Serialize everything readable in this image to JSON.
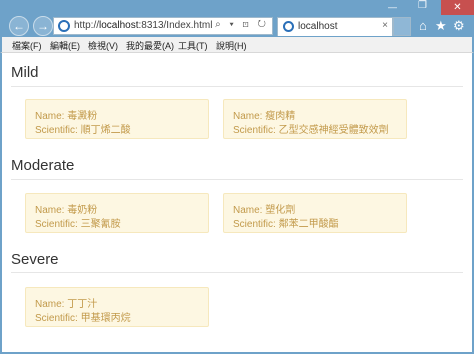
{
  "browser": {
    "url_prefix": "http://",
    "url_host": "localhost",
    "url_rest": ":8313/Index.html",
    "address_icons": "⌕ ▾ ⊡ ↻",
    "tab_title": "localhost",
    "tab_close": "×",
    "window_controls": {
      "minimize": "—",
      "maximize": "❐",
      "close": "✕"
    },
    "nav_back": "←",
    "nav_forward": "→",
    "tool_icons": {
      "home": "⌂",
      "favorites": "★",
      "settings": "⚙"
    }
  },
  "menu": [
    "檔案(F)",
    "編輯(E)",
    "檢視(V)",
    "我的最愛(A)",
    "工具(T)",
    "說明(H)"
  ],
  "sections": [
    {
      "title": "Mild",
      "cards": [
        {
          "name": "Name: 毒澱粉",
          "scientific": "Scientific: 順丁烯二酸"
        },
        {
          "name": "Name: 瘦肉精",
          "scientific": "Scientific: 乙型交感神經受體致效劑"
        }
      ]
    },
    {
      "title": "Moderate",
      "cards": [
        {
          "name": "Name: 毒奶粉",
          "scientific": "Scientific: 三聚氰胺"
        },
        {
          "name": "Name: 塑化劑",
          "scientific": "Scientific: 鄰苯二甲酸酯"
        }
      ]
    },
    {
      "title": "Severe",
      "cards": [
        {
          "name": "Name: 丁丁汁",
          "scientific": "Scientific: 甲基環丙烷"
        }
      ]
    }
  ]
}
